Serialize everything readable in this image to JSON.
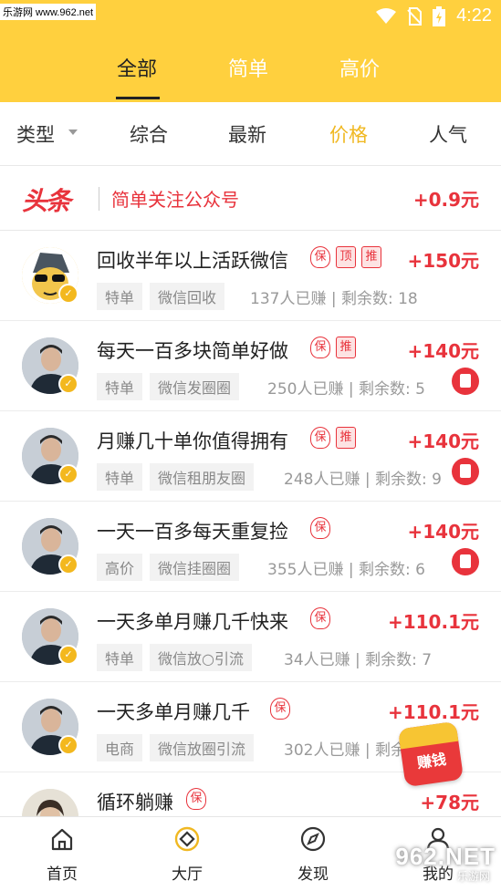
{
  "status_bar": {
    "watermark": "乐游网 www.962.net",
    "time": "4:22"
  },
  "top_tabs": [
    {
      "label": "全部",
      "active": true
    },
    {
      "label": "简单",
      "active": false
    },
    {
      "label": "高价",
      "active": false
    }
  ],
  "filters": {
    "type": "类型",
    "options": [
      "综合",
      "最新",
      "价格",
      "人气"
    ],
    "active": "价格"
  },
  "promo": {
    "logo": "头条",
    "title": "简单关注公众号",
    "price": "+0.9元"
  },
  "tasks": [
    {
      "title": "回收半年以上活跃微信",
      "tags": [
        "保",
        "顶",
        "推"
      ],
      "price": "+150元",
      "chips": [
        "特单",
        "微信回收"
      ],
      "meta": "137人已赚 | 剩余数: 18",
      "redpack": false
    },
    {
      "title": "每天一百多块简单好做",
      "tags": [
        "保",
        "推"
      ],
      "price": "+140元",
      "chips": [
        "特单",
        "微信发圈圈"
      ],
      "meta": "250人已赚 | 剩余数: 5",
      "redpack": true
    },
    {
      "title": "月赚几十单你值得拥有",
      "tags": [
        "保",
        "推"
      ],
      "price": "+140元",
      "chips": [
        "特单",
        "微信租朋友圈"
      ],
      "meta": "248人已赚 | 剩余数: 9",
      "redpack": true
    },
    {
      "title": "一天一百多每天重复捡",
      "tags": [
        "保"
      ],
      "price": "+140元",
      "chips": [
        "高价",
        "微信挂圈圈"
      ],
      "meta": "355人已赚 | 剩余数: 6",
      "redpack": true
    },
    {
      "title": "一天多单月赚几千快来",
      "tags": [
        "保"
      ],
      "price": "+110.1元",
      "chips": [
        "特单",
        "微信放○引流"
      ],
      "meta": "34人已赚 | 剩余数: 7",
      "redpack": false
    },
    {
      "title": "一天多单月赚几千",
      "tags": [
        "保"
      ],
      "price": "+110.1元",
      "chips": [
        "电商",
        "微信放圈引流"
      ],
      "meta": "302人已赚 | 剩余数: 2",
      "redpack": false
    },
    {
      "title": "循环躺赚",
      "tags": [
        "保"
      ],
      "price": "+78元",
      "chips": [],
      "meta": "",
      "redpack": false
    }
  ],
  "earn_float": "赚钱",
  "bottom_nav": [
    {
      "label": "首页",
      "icon": "home-icon"
    },
    {
      "label": "大厅",
      "icon": "hall-icon"
    },
    {
      "label": "发现",
      "icon": "compass-icon"
    },
    {
      "label": "我的",
      "icon": "profile-icon"
    }
  ],
  "watermark_bottom": "962.NET",
  "watermark_bottom_sub": "乐游网",
  "colors": {
    "header": "#ffd03e",
    "accent_red": "#e8333c",
    "active_filter": "#f0b822"
  }
}
